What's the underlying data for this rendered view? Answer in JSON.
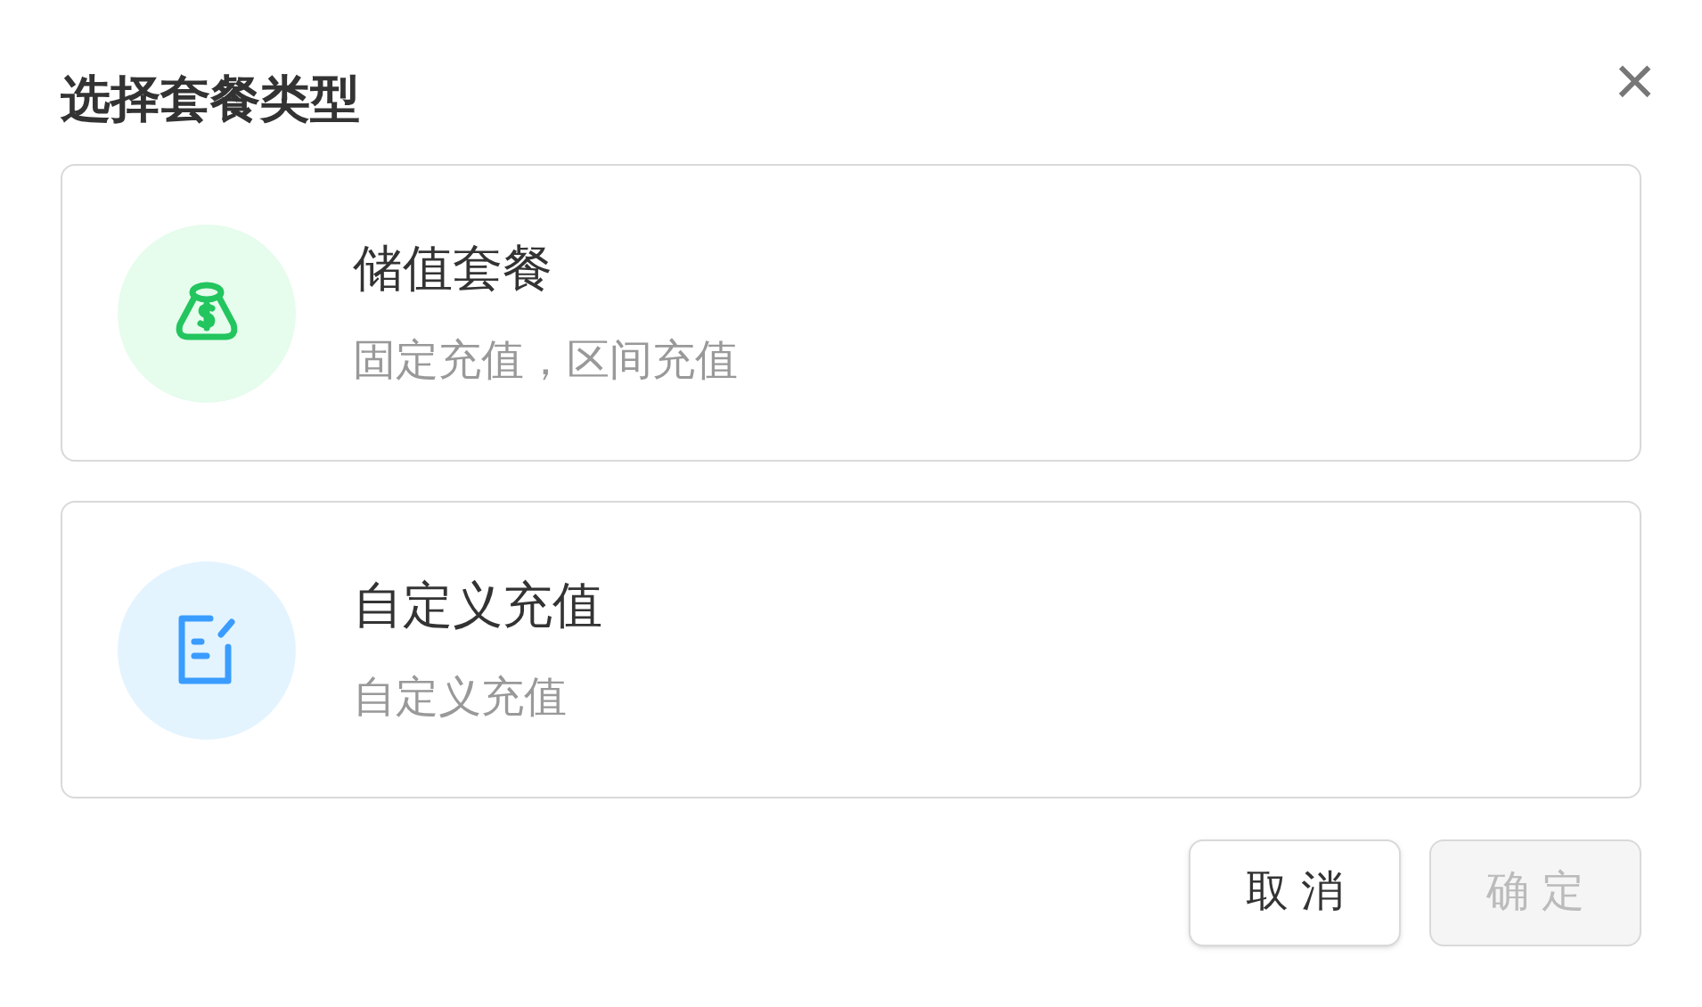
{
  "dialog": {
    "title": "选择套餐类型",
    "close": "×"
  },
  "options": [
    {
      "kind": "stored",
      "title": "储值套餐",
      "description": "固定充值，区间充值"
    },
    {
      "kind": "custom",
      "title": "自定义充值",
      "description": "自定义充值"
    }
  ],
  "buttons": [
    {
      "kind": "cancel",
      "label": "取 消",
      "disabled": false
    },
    {
      "kind": "confirm",
      "label": "确 定",
      "disabled": true
    }
  ]
}
